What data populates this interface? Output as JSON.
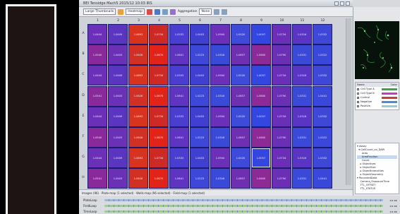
{
  "window": {
    "title": "BEI Tensidge Mach5 2015/12 10:03 IRS"
  },
  "toolbar": {
    "view_select": "Large Thumbnails",
    "mode_label": "Heatmap",
    "aggregation_label": "Aggregation",
    "aggregation_value": "None"
  },
  "grid": {
    "columns": [
      "1",
      "2",
      "3",
      "4",
      "5",
      "6",
      "7",
      "8",
      "9",
      "10",
      "11",
      "12"
    ],
    "rows": [
      {
        "label": "A",
        "values": [
          "1.0444",
          "1.0409",
          "1.0693",
          "1.0734",
          "1.0333",
          "1.0403",
          "1.0904",
          "1.0020",
          "1.0057",
          "1.0734",
          "1.0316",
          "1.0332"
        ],
        "colors": [
          "#6b2fb8",
          "#5a36c0",
          "#d8331f",
          "#ce2a25",
          "#4a3dd0",
          "#4040d0",
          "#6b2fb8",
          "#3d4bd8",
          "#3346e0",
          "#6a2fb6",
          "#5a34c2",
          "#3f47d6"
        ]
      },
      {
        "label": "B",
        "values": [
          "1.0540",
          "1.0403",
          "1.0626",
          "1.0870",
          "1.0641",
          "1.0223",
          "1.0316",
          "1.0657",
          "1.0600",
          "1.0790",
          "1.0331",
          "1.0322"
        ],
        "colors": [
          "#8a2a9a",
          "#6a30b6",
          "#d23024",
          "#e22418",
          "#5e34c0",
          "#3d47d8",
          "#3a4ad8",
          "#6e2fb0",
          "#8e2a96",
          "#6a2fb4",
          "#3b49d8",
          "#3947da"
        ]
      },
      {
        "label": "C",
        "values": [
          "1.0444",
          "1.0409",
          "1.0693",
          "1.0734",
          "1.0333",
          "1.0403",
          "1.0904",
          "1.0020",
          "1.0057",
          "1.0734",
          "1.0316",
          "1.0332"
        ],
        "colors": [
          "#6b2fb8",
          "#5a36c0",
          "#d8331f",
          "#ce2a25",
          "#4a3dd0",
          "#4040d0",
          "#6b2fb8",
          "#3d4bd8",
          "#3346e0",
          "#6a2fb6",
          "#5a34c2",
          "#3f47d6"
        ]
      },
      {
        "label": "D",
        "values": [
          "1.0541",
          "1.0403",
          "1.0626",
          "1.0870",
          "1.0641",
          "1.0223",
          "1.0316",
          "1.0657",
          "1.0600",
          "1.0790",
          "1.0331",
          "1.0441"
        ],
        "colors": [
          "#8a2a9a",
          "#6a30b6",
          "#d23024",
          "#e22418",
          "#5e34c0",
          "#3d47d8",
          "#3a4ad8",
          "#6e2fb0",
          "#8e2a96",
          "#6a2fb4",
          "#3b49d8",
          "#3947da"
        ]
      },
      {
        "label": "E",
        "values": [
          "1.0444",
          "1.0409",
          "1.0693",
          "1.0734",
          "1.0333",
          "1.0403",
          "1.0904",
          "1.0020",
          "1.0057",
          "1.0734",
          "1.0316",
          "1.0332"
        ],
        "colors": [
          "#6b2fb8",
          "#5a36c0",
          "#d8331f",
          "#ce2a25",
          "#4a3dd0",
          "#4040d0",
          "#6b2fb8",
          "#3d4bd8",
          "#3346e0",
          "#6a2fb6",
          "#5a34c2",
          "#3f47d6"
        ]
      },
      {
        "label": "F",
        "values": [
          "1.0540",
          "1.0403",
          "1.0626",
          "1.0870",
          "1.0641",
          "1.0223",
          "1.0316",
          "1.0657",
          "1.0600",
          "1.0790",
          "1.0331",
          "1.0322"
        ],
        "colors": [
          "#8a2a9a",
          "#6a30b6",
          "#d23024",
          "#e22418",
          "#5e34c0",
          "#3d47d8",
          "#3a4ad8",
          "#6e2fb0",
          "#8e2a96",
          "#6a2fb4",
          "#3b49d8",
          "#3947da"
        ]
      },
      {
        "label": "G",
        "values": [
          "1.0444",
          "1.0409",
          "1.0693",
          "1.0734",
          "1.0333",
          "1.0403",
          "1.0904",
          "1.0020",
          "1.0057",
          "1.0734",
          "1.0316",
          "1.0332"
        ],
        "colors": [
          "#6b2fb8",
          "#5a36c0",
          "#d8331f",
          "#ce2a25",
          "#4a3dd0",
          "#4040d0",
          "#6b2fb8",
          "#3d4bd8",
          "#3346e0",
          "#6a2fb6",
          "#5a34c2",
          "#3f47d6"
        ]
      },
      {
        "label": "H",
        "values": [
          "1.0541",
          "1.0403",
          "1.0626",
          "1.0870",
          "1.0641",
          "1.0223",
          "1.0316",
          "1.0657",
          "1.0600",
          "1.0790",
          "1.0331",
          "1.0441"
        ],
        "colors": [
          "#8a2a9a",
          "#6a30b6",
          "#d23024",
          "#e22418",
          "#5e34c0",
          "#3d47d8",
          "#3a4ad8",
          "#6e2fb0",
          "#8e2a96",
          "#6a2fb4",
          "#3b49d8",
          "#3947da"
        ]
      }
    ],
    "selected_well": "G9"
  },
  "status": {
    "text": "Images (96) · Plate-map (1 selected) · Wells-map (96 selected) · Field-map (1 selected)"
  },
  "legend": {
    "header_name": "Name",
    "header_color": "Color",
    "items": [
      {
        "name": "Cell Type A",
        "color": "#3fa24b"
      },
      {
        "name": "Cell Type B",
        "color": "#c23ac9"
      },
      {
        "name": "Control",
        "color": "#d23a3a"
      },
      {
        "name": "Negative",
        "color": "#4b8cd8"
      },
      {
        "name": "Positive",
        "color": "#8fd0d8"
      }
    ]
  },
  "tree": {
    "items": [
      "▾ Assay",
      "  ▾ CellCount_on_DAPI",
      "      Area",
      "      AreaFraction",
      "      Count",
      "    ▸ Objectives",
      "    ▸ ObjectSize",
      "    ▸ ObjectIntensities",
      "    ▸ ObjectGeometry",
      "▾ RecordedData",
      "    Camera_ExposureTime",
      "    TTL_OFFSET",
      "    TTL_STATUS"
    ],
    "highlight_index": 3
  },
  "bottom_rows": [
    {
      "label": "PlateLoop",
      "color": "#9fb6d6"
    },
    {
      "label": "FieldLoop",
      "color": "#a3c79a"
    },
    {
      "label": "TimeLoop",
      "color": "#a3c79a"
    }
  ]
}
